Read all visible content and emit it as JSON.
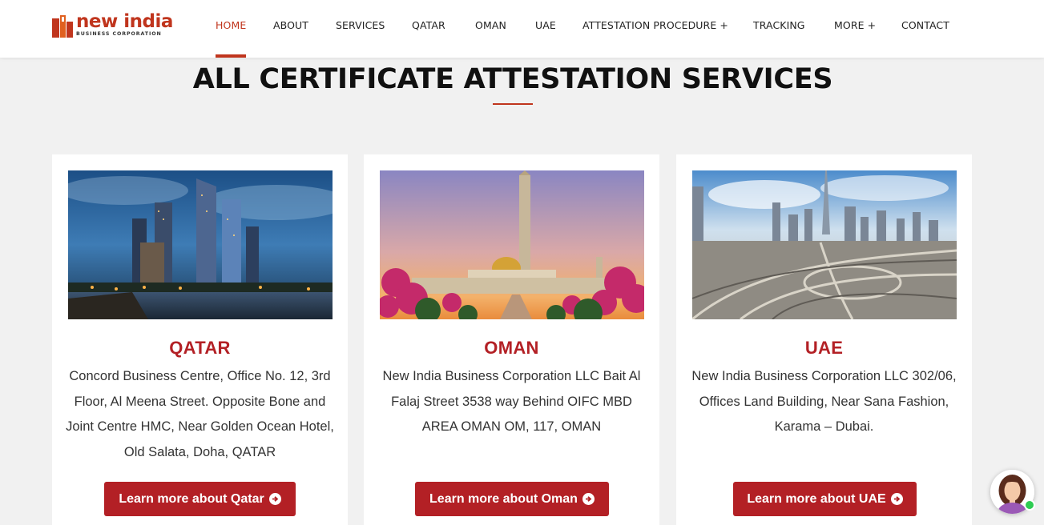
{
  "brand": {
    "name": "new india",
    "subtitle": "BUSINESS CORPORATION",
    "color": "#c0351d"
  },
  "nav": {
    "items": [
      {
        "label": "HOME",
        "active": true
      },
      {
        "label": "ABOUT"
      },
      {
        "label": "SERVICES"
      },
      {
        "label": "QATAR"
      },
      {
        "label": "OMAN"
      },
      {
        "label": "UAE"
      },
      {
        "label": "ATTESTATION PROCEDURE +"
      },
      {
        "label": "TRACKING"
      },
      {
        "label": "MORE +"
      },
      {
        "label": "CONTACT"
      }
    ]
  },
  "section": {
    "title": "ALL CERTIFICATE ATTESTATION SERVICES"
  },
  "cards": [
    {
      "title": "QATAR",
      "address": "Concord Business Centre, Office No. 12, 3rd Floor, Al Meena Street. Opposite Bone and Joint Centre HMC, Near Golden Ocean Hotel, Old Salata, Doha, QATAR",
      "button": "Learn more about Qatar",
      "image": "doha-skyline-night"
    },
    {
      "title": "OMAN",
      "address": "New India Business Corporation LLC Bait Al Falaj Street 3538 way Behind OIFC MBD AREA OMAN OM, 117, OMAN",
      "button": "Learn more about Oman",
      "image": "grand-mosque-sunset"
    },
    {
      "title": "UAE",
      "address": "New India Business Corporation LLC 302/06, Offices Land Building, Near Sana Fashion, Karama – Dubai.",
      "button": "Learn more about UAE",
      "image": "dubai-highway-aerial"
    }
  ],
  "colors": {
    "accent": "#b32025",
    "background": "#f1f1f1"
  }
}
